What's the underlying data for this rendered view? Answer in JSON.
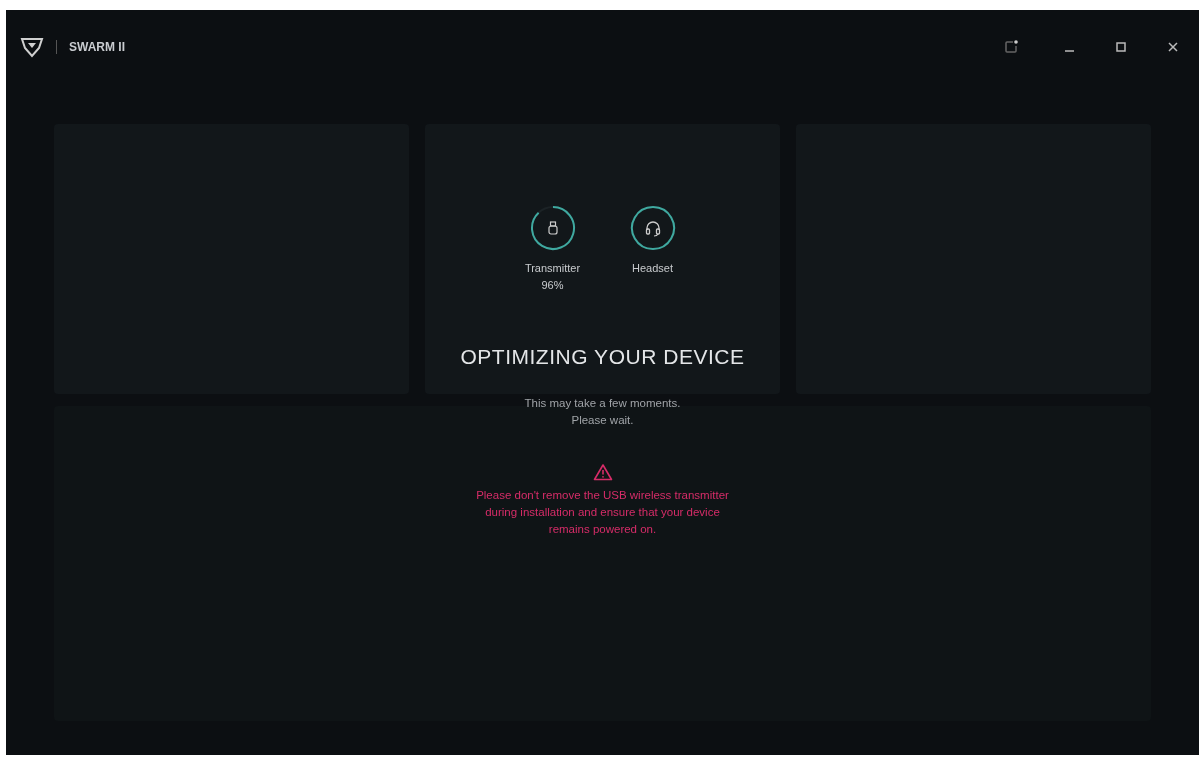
{
  "window": {
    "title": "SWARM II"
  },
  "devices": [
    {
      "kind": "transmitter",
      "label": "Transmitter",
      "reading": "96%",
      "level": 0.88
    },
    {
      "kind": "headset",
      "label": "Headset",
      "level": 1
    }
  ],
  "overlay": {
    "heading": "OPTIMIZING YOUR DEVICE",
    "message_lines": [
      "This may take a few moments.",
      "Please wait."
    ],
    "warning": "Please don't remove the USB wireless transmitter during installation and ensure that your device remains powered on."
  }
}
